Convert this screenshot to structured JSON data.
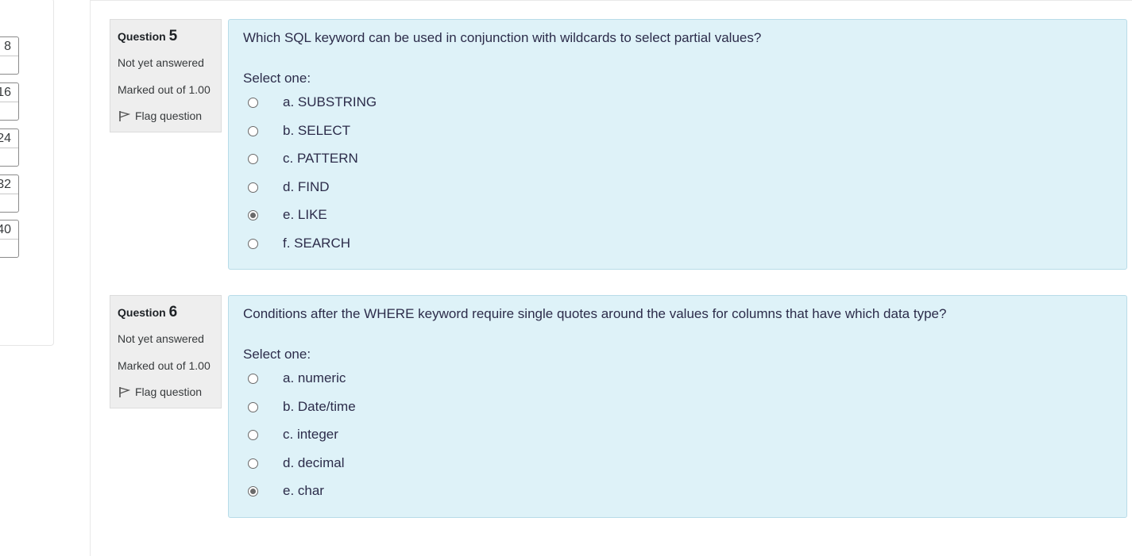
{
  "nav": {
    "buttons": [
      "8",
      "16",
      "24",
      "32",
      "40"
    ]
  },
  "questions": [
    {
      "label": "Question",
      "number": "5",
      "state": "Not yet answered",
      "grade": "Marked out of 1.00",
      "flag_label": "Flag question",
      "text": "Which SQL keyword can be used in conjunction with wildcards to select partial values?",
      "prompt": "Select one:",
      "options": [
        {
          "label": "a. SUBSTRING",
          "checked": false
        },
        {
          "label": "b. SELECT",
          "checked": false
        },
        {
          "label": "c. PATTERN",
          "checked": false
        },
        {
          "label": "d. FIND",
          "checked": false
        },
        {
          "label": "e. LIKE",
          "checked": true
        },
        {
          "label": "f. SEARCH",
          "checked": false
        }
      ]
    },
    {
      "label": "Question",
      "number": "6",
      "state": "Not yet answered",
      "grade": "Marked out of 1.00",
      "flag_label": "Flag question",
      "text": "Conditions after the WHERE keyword require single quotes around the values for columns that have which data type?",
      "prompt": "Select one:",
      "options": [
        {
          "label": "a. numeric",
          "checked": false
        },
        {
          "label": "b. Date/time",
          "checked": false
        },
        {
          "label": "c. integer",
          "checked": false
        },
        {
          "label": "d. decimal",
          "checked": false
        },
        {
          "label": "e. char",
          "checked": true
        }
      ]
    }
  ],
  "colors": {
    "formulation_bg": "#def2f8",
    "info_bg": "#eeeeee",
    "text": "#2c2c4a"
  }
}
